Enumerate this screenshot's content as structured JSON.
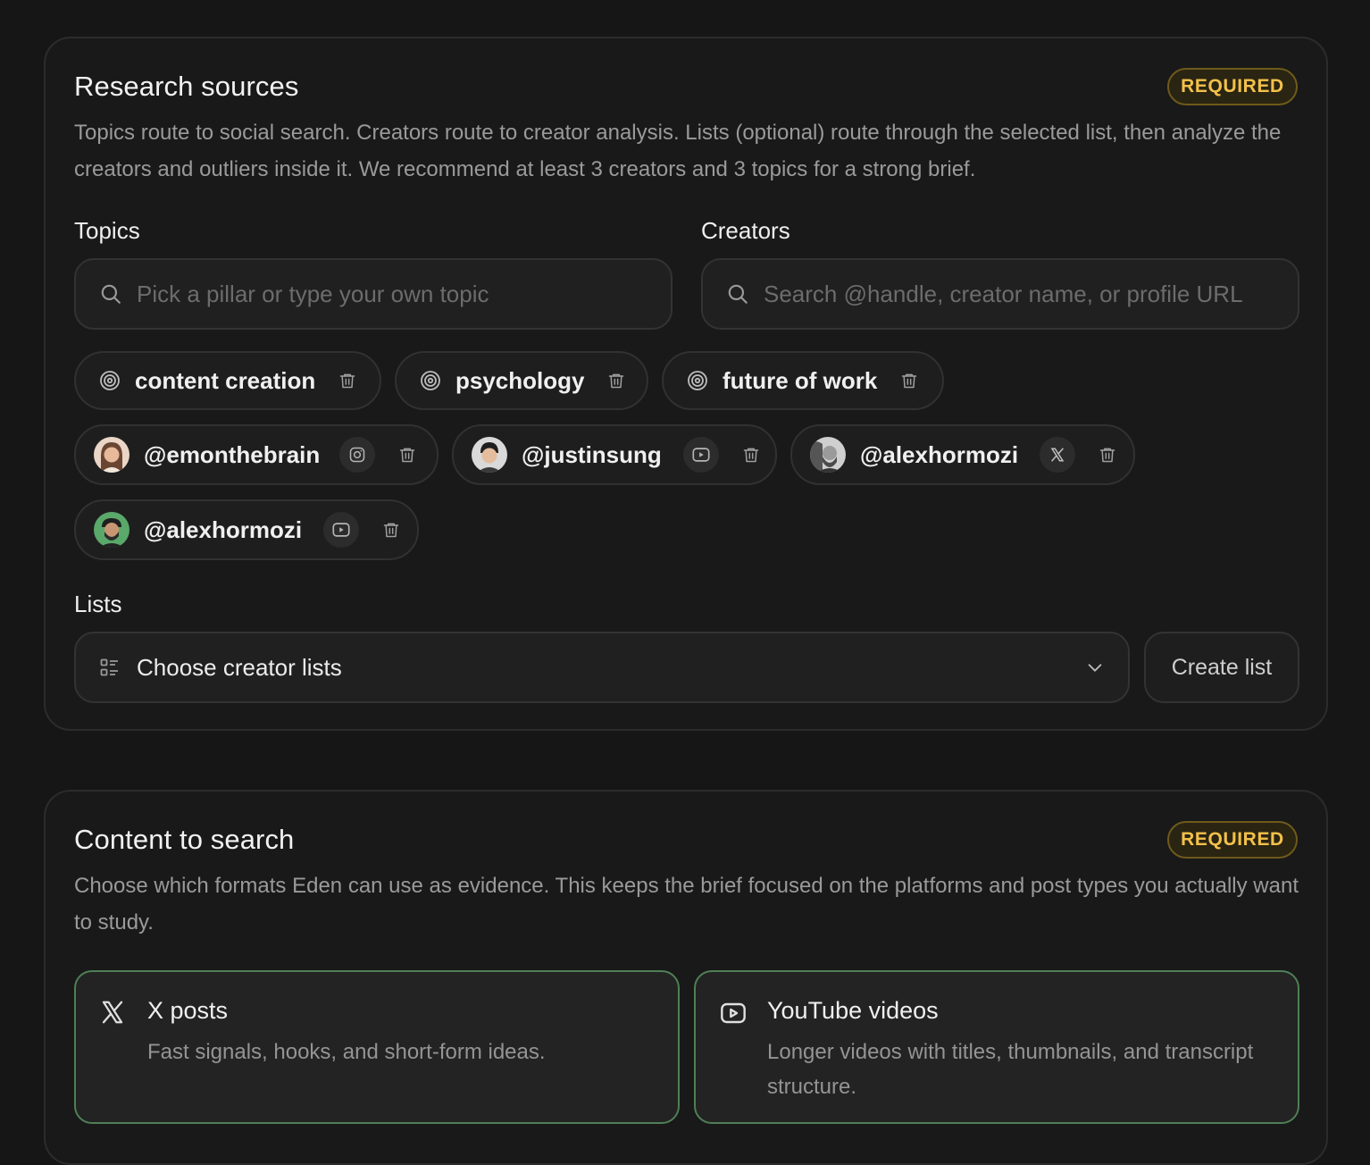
{
  "research_sources": {
    "title": "Research sources",
    "badge": "REQUIRED",
    "description": "Topics route to social search. Creators route to creator analysis. Lists (optional) route through the selected list, then analyze the creators and outliers inside it. We recommend at least 3 creators and 3 topics for a strong brief.",
    "topics": {
      "label": "Topics",
      "placeholder": "Pick a pillar or type your own topic",
      "chips": [
        {
          "label": "content creation",
          "icon": "target-icon"
        },
        {
          "label": "psychology",
          "icon": "target-icon"
        },
        {
          "label": "future of work",
          "icon": "target-icon"
        }
      ]
    },
    "creators": {
      "label": "Creators",
      "placeholder": "Search @handle, creator name, or profile URL",
      "chips": [
        {
          "handle": "@emonthebrain",
          "platform": "instagram-icon"
        },
        {
          "handle": "@justinsung",
          "platform": "youtube-icon"
        },
        {
          "handle": "@alexhormozi",
          "platform": "x-icon"
        },
        {
          "handle": "@alexhormozi",
          "platform": "youtube-icon"
        }
      ]
    },
    "lists": {
      "label": "Lists",
      "select_label": "Choose creator lists",
      "create_button": "Create list"
    }
  },
  "content_to_search": {
    "title": "Content to search",
    "badge": "REQUIRED",
    "description": "Choose which formats Eden can use as evidence. This keeps the brief focused on the platforms and post types you actually want to study.",
    "formats": [
      {
        "title": "X posts",
        "description": "Fast signals, hooks, and short-form ideas.",
        "icon": "x-icon"
      },
      {
        "title": "YouTube videos",
        "description": "Longer videos with titles, thumbnails, and transcript structure.",
        "icon": "youtube-icon"
      }
    ]
  },
  "colors": {
    "background": "#161616",
    "card": "#191919",
    "badge_text": "#f2c14a",
    "selected_border": "#4f7f57"
  }
}
